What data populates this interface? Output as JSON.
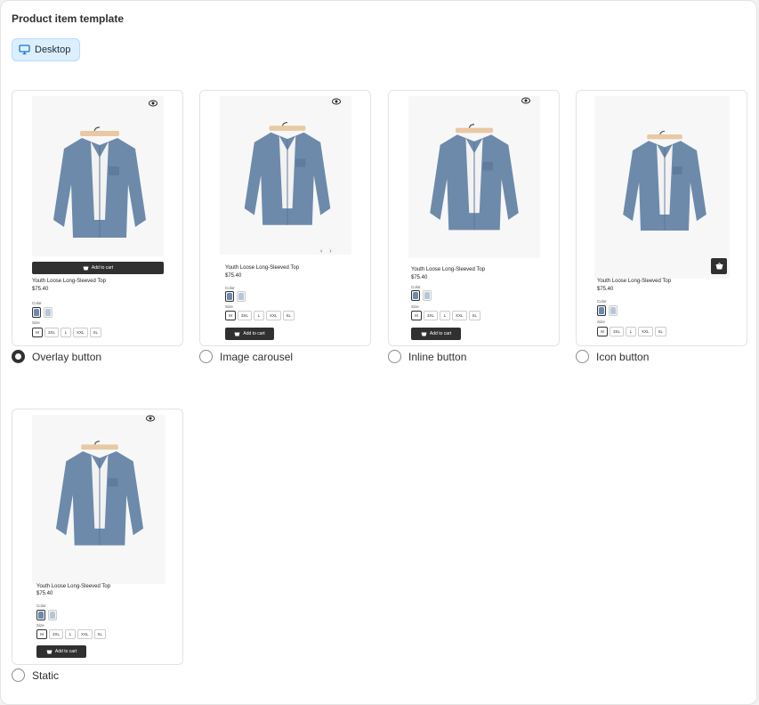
{
  "header": {
    "title": "Product item template"
  },
  "device": {
    "label": "Desktop",
    "icon": "desktop-icon"
  },
  "product": {
    "title": "Youth Loose Long-Sleeved Top",
    "price": "$75.40",
    "color_label": "Color",
    "size_label": "Size",
    "sizes": [
      "M",
      "3XL",
      "L",
      "XXL",
      "XL"
    ],
    "selected_size": "M",
    "add_to_cart": "Add to cart"
  },
  "options": [
    {
      "label": "Overlay button",
      "checked": true
    },
    {
      "label": "Image carousel",
      "checked": false
    },
    {
      "label": "Inline button",
      "checked": false
    },
    {
      "label": "Icon button",
      "checked": false
    },
    {
      "label": "Static",
      "checked": false
    }
  ],
  "carousel": {
    "prev": "‹",
    "next": "›"
  },
  "colors": {
    "primary": "#303030",
    "pill_bg": "#dcefff",
    "pill_border": "#b6dcff",
    "shirt": "#6d8aab"
  }
}
